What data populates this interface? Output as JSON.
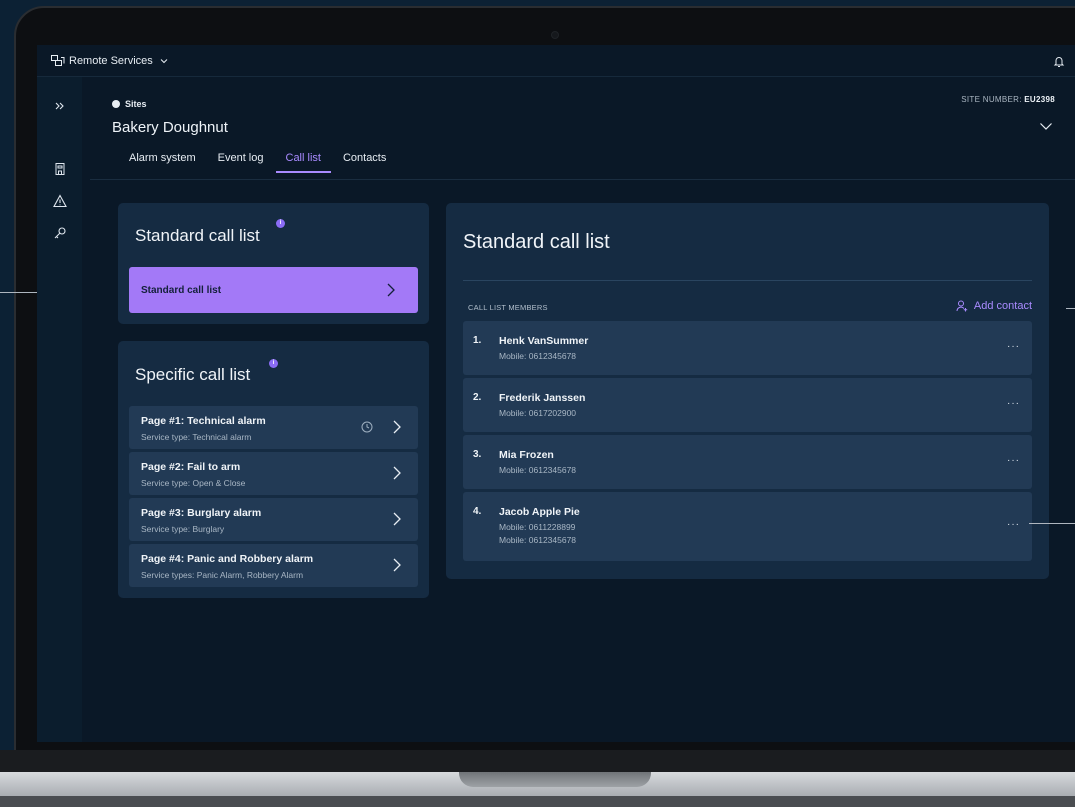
{
  "topbar": {
    "app_name": "Remote Services"
  },
  "header": {
    "breadcrumb": "Sites",
    "site_name": "Bakery Doughnut",
    "site_number_label": "SITE NUMBER:",
    "site_number": "EU2398"
  },
  "tabs": [
    {
      "label": "Alarm system",
      "active": false
    },
    {
      "label": "Event log",
      "active": false
    },
    {
      "label": "Call list",
      "active": true
    },
    {
      "label": "Contacts",
      "active": false
    }
  ],
  "standard_panel": {
    "title": "Standard call list",
    "item_label": "Standard call list"
  },
  "specific_panel": {
    "title": "Specific call list",
    "pages": [
      {
        "title": "Page #1: Technical alarm",
        "sub": "Service type: Technical alarm",
        "has_clock": true
      },
      {
        "title": "Page #2: Fail to arm",
        "sub": "Service type: Open & Close",
        "has_clock": false
      },
      {
        "title": "Page #3: Burglary alarm",
        "sub": "Service type: Burglary",
        "has_clock": false
      },
      {
        "title": "Page #4: Panic and Robbery alarm",
        "sub": "Service types: Panic Alarm, Robbery Alarm",
        "has_clock": false
      }
    ]
  },
  "call_list": {
    "title": "Standard call list",
    "members_label": "CALL LIST MEMBERS",
    "add_contact_label": "Add contact",
    "members": [
      {
        "num": "1.",
        "name": "Henk VanSummer",
        "phones": [
          "Mobile: 0612345678"
        ]
      },
      {
        "num": "2.",
        "name": "Frederik Janssen",
        "phones": [
          "Mobile: 0617202900"
        ]
      },
      {
        "num": "3.",
        "name": "Mia Frozen",
        "phones": [
          "Mobile: 0612345678"
        ]
      },
      {
        "num": "4.",
        "name": "Jacob Apple Pie",
        "phones": [
          "Mobile: 0611228899",
          "Mobile: 0612345678"
        ]
      }
    ],
    "more_label": "···"
  },
  "colors": {
    "accent": "#a98bff",
    "primary_button": "#a379f7",
    "panel": "#152b42",
    "card": "#223a55",
    "screen_bg": "#0a1827"
  },
  "icons": [
    "app-switch-icon",
    "chevron-down-icon",
    "bell-icon",
    "expand-sidebar-icon",
    "building-icon",
    "warning-icon",
    "key-icon",
    "info-icon",
    "chevron-right-icon",
    "clock-icon",
    "add-user-icon",
    "more-icon"
  ]
}
